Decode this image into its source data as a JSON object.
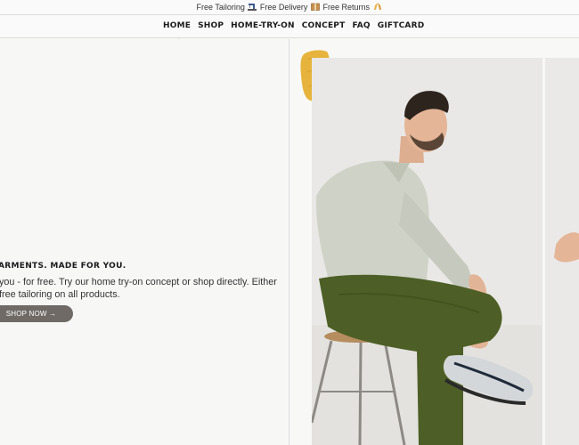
{
  "announcement": {
    "tailoring": "Free Tailoring",
    "delivery": "Free Delivery",
    "returns": "Free Returns",
    "icons": [
      "sewing-machine-icon",
      "package-icon",
      "hands-icon"
    ]
  },
  "nav": {
    "items": [
      "HOME",
      "SHOP",
      "HOME-TRY-ON",
      "CONCEPT",
      "FAQ",
      "GIFTCARD"
    ]
  },
  "hero": {
    "heading": "ARMENTS. MADE FOR YOU.",
    "body_line1": "you - for free. Try our home try-on concept or shop directly. Either",
    "body_line2": " free tailoring on all products.",
    "cta": "SHOP NOW →"
  },
  "colors": {
    "button": "#6f6a66",
    "accent_yellow": "#e6b43c",
    "shirt": "#cfd2c7",
    "pants": "#4d5f26"
  }
}
